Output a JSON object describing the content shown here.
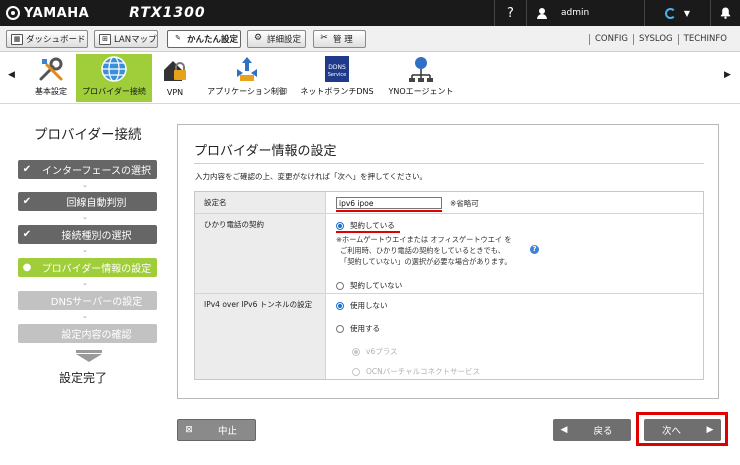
{
  "header": {
    "brand": "YAMAHA",
    "model": "RTX1300",
    "help_label": "?",
    "user": "admin",
    "bell": "🔔"
  },
  "nav": {
    "tabs": [
      {
        "label": "ダッシュボード",
        "icon": "dashboard-icon"
      },
      {
        "label": "LANマップ",
        "icon": "lan-map-icon"
      },
      {
        "label": "かんたん設定",
        "icon": "wizard-icon"
      },
      {
        "label": "詳細設定",
        "icon": "gear-icon"
      },
      {
        "label": "管 理",
        "icon": "tools-icon"
      }
    ],
    "links": [
      "CONFIG",
      "SYSLOG",
      "TECHINFO"
    ]
  },
  "toolbar": {
    "left_arrow": "◀",
    "right_arrow": "▶",
    "items": [
      {
        "label": "基本設定",
        "icon": "wrench-screwdriver-icon"
      },
      {
        "label": "プロバイダー接続",
        "icon": "globe-icon"
      },
      {
        "label": "VPN",
        "icon": "lock-house-icon"
      },
      {
        "label": "アプリケーション制御",
        "icon": "app-control-icon"
      },
      {
        "label": "ネットボランチDNS",
        "icon": "ddns-service-icon"
      },
      {
        "label": "YNOエージェント",
        "icon": "network-agent-icon"
      }
    ],
    "ddns_icon_text": [
      "DDNS",
      "Service"
    ]
  },
  "wizard": {
    "title": "プロバイダー接続",
    "steps": [
      {
        "label": "インターフェースの選択",
        "state": "done"
      },
      {
        "label": "回線自動判別",
        "state": "done"
      },
      {
        "label": "接続種別の選択",
        "state": "done"
      },
      {
        "label": "プロバイダー情報の設定",
        "state": "current"
      },
      {
        "label": "DNSサーバーの設定",
        "state": "todo"
      },
      {
        "label": "設定内容の確認",
        "state": "todo"
      }
    ],
    "chevron": "⌄",
    "finish": "設定完了"
  },
  "form": {
    "title": "プロバイダー情報の設定",
    "description": "入力内容をご確認の上、変更がなければ「次へ」を押してください。",
    "setting_name_label": "設定名",
    "setting_name_value": "ipv6 ipoe",
    "optional_hint": "※省略可",
    "hikari_label": "ひかり電話の契約",
    "hikari_yes": "契約している",
    "hikari_note_1": "※ホームゲートウエイまたは オフィスゲートウエイ を",
    "hikari_note_2": "ご利用時、ひかり電話の契約をしているときでも、",
    "hikari_note_3": "「契約していない」の選択が必要な場合があります。",
    "hikari_no": "契約していない",
    "tunnel_label": "IPv4 over IPv6 トンネルの設定",
    "tunnel_off": "使用しない",
    "tunnel_on": "使用する",
    "tunnel_v6plus": "v6プラス",
    "tunnel_ocn": "OCNバーチャルコネクトサービス"
  },
  "buttons": {
    "cancel": "中止",
    "back": "戻る",
    "next": "次へ"
  },
  "colors": {
    "accent_green": "#9fce3a",
    "highlight_red": "#e00000",
    "radio_blue": "#1a6fd1"
  }
}
